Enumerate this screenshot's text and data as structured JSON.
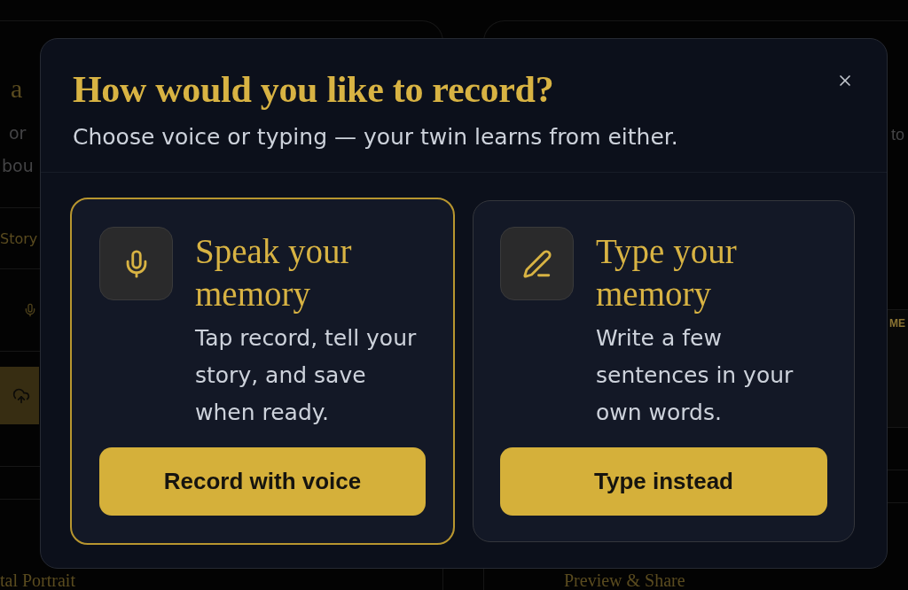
{
  "background": {
    "left_panel": {
      "title": "a",
      "description_lines": [
        "or",
        "bou"
      ],
      "tab": "Story",
      "heading": "tal Portrait"
    },
    "right_panel": {
      "text": "to",
      "bar_label": "ME",
      "heading": "Preview & Share"
    }
  },
  "dialog": {
    "title": "How would you like to record?",
    "subtitle": "Choose voice or typing — your twin learns from either.",
    "options": [
      {
        "kind": "voice",
        "selected": true,
        "title": "Speak your memory",
        "description": "Tap record, tell your story, and save when ready.",
        "button": "Record with voice"
      },
      {
        "kind": "text",
        "selected": false,
        "title": "Type your memory",
        "description": "Write a few sentences in your own words.",
        "button": "Type instead"
      }
    ]
  }
}
